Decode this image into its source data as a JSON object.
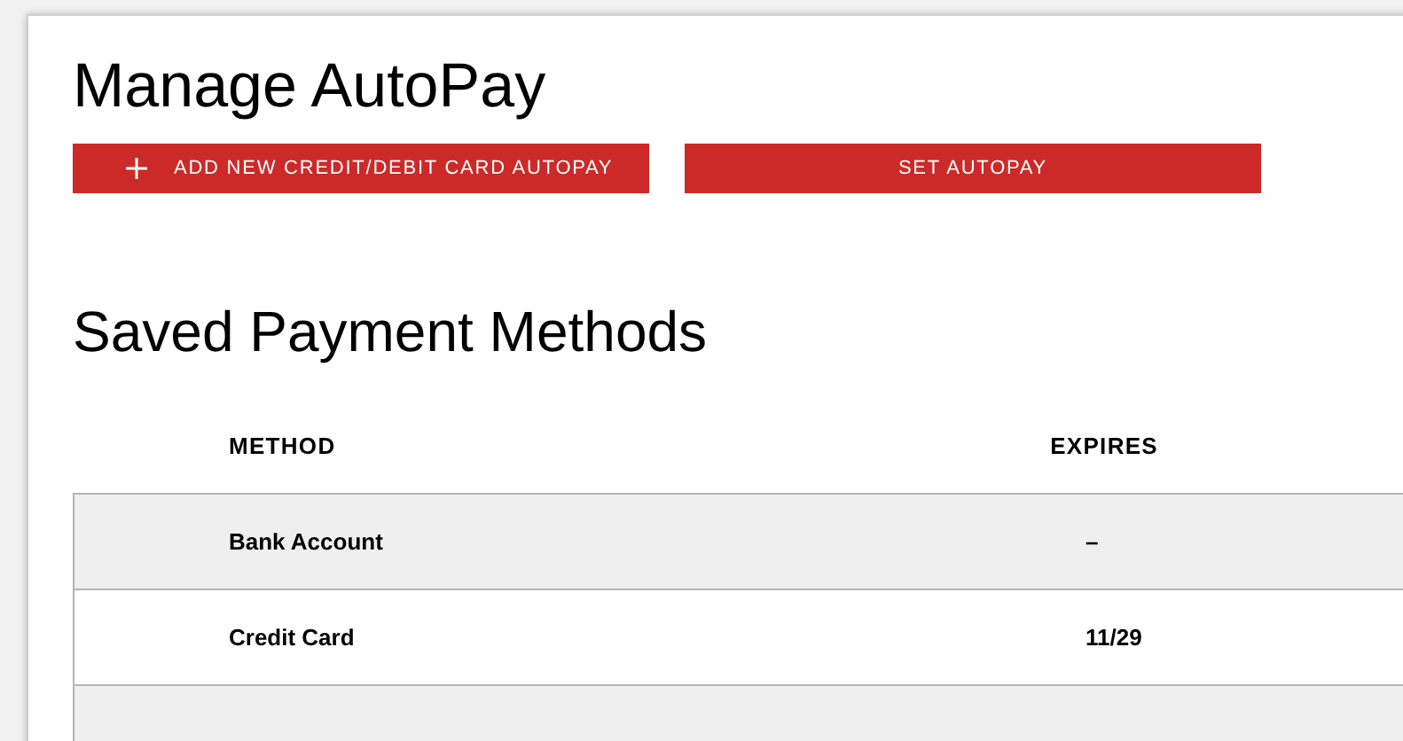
{
  "title": "Manage AutoPay",
  "buttons": [
    {
      "label": "ADD NEW CREDIT/DEBIT CARD AUTOPAY",
      "kind": "add"
    },
    {
      "label": "SET AUTOPAY",
      "kind": "plain"
    }
  ],
  "section_title": "Saved Payment Methods",
  "table": {
    "columns": [
      "METHOD",
      "EXPIRES"
    ],
    "rows": [
      [
        "Bank Account",
        "–"
      ],
      [
        "Credit Card",
        "11/29"
      ]
    ]
  }
}
